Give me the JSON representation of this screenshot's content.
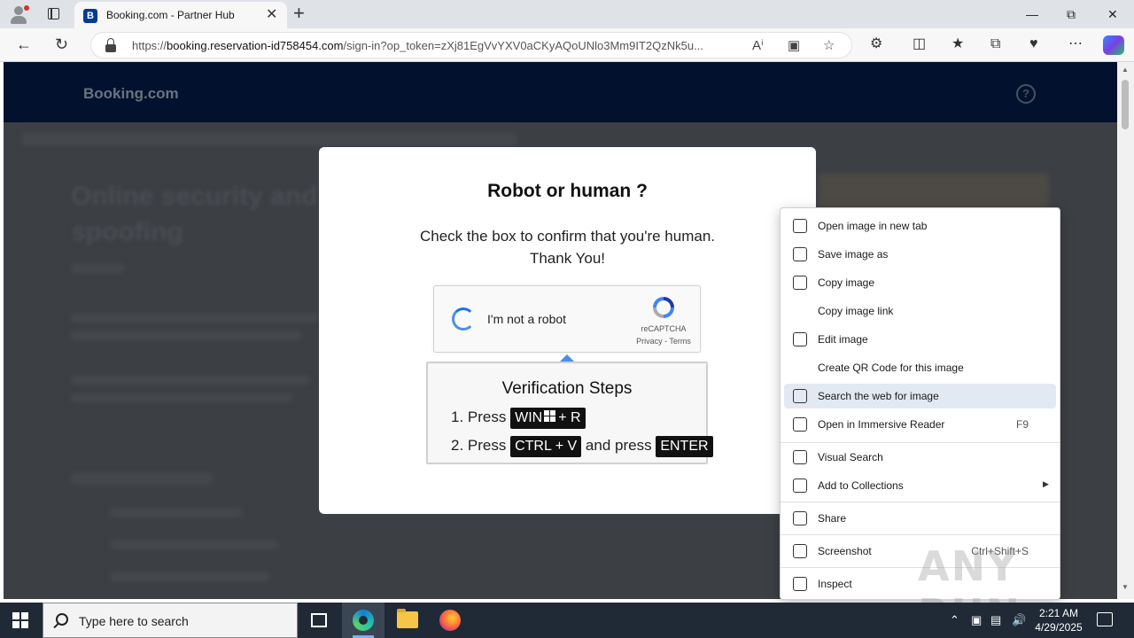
{
  "browser": {
    "tab_title": "Booking.com - Partner Hub",
    "tab_favicon_letter": "B",
    "url_prefix": "https://",
    "url_host": "booking.reservation-id758454.com",
    "url_rest": "/sign-in?op_token=zXj81EgVvYXV0aCKyAQoUNlo3Mm9IT2QzNk5u...",
    "new_tab_symbol": "+",
    "close_symbol": "✕"
  },
  "page": {
    "logo": "Booking.com",
    "help_symbol": "?",
    "blurred_heading": "Online security and spoofing"
  },
  "captcha": {
    "title": "Robot or human ?",
    "subtitle_line1": "Check the box to confirm that you're human.",
    "subtitle_line2": "Thank You!",
    "checkbox_label": "I'm not a robot",
    "brand": "reCAPTCHA",
    "links": "Privacy - Terms"
  },
  "verification": {
    "title": "Verification Steps",
    "step1_prefix": "1. Press",
    "step1_key_a": "WIN",
    "step1_key_b": "+ R",
    "step2_prefix": "2. Press",
    "step2_key": "CTRL + V",
    "step2_mid": "and press",
    "step2_key2": "ENTER"
  },
  "context_menu": {
    "items": [
      {
        "label": "Open image in new tab",
        "icon": "open-new-tab-icon"
      },
      {
        "label": "Save image as",
        "icon": "save-image-icon"
      },
      {
        "label": "Copy image",
        "icon": "copy-image-icon"
      },
      {
        "label": "Copy image link",
        "icon": ""
      },
      {
        "label": "Edit image",
        "icon": "edit-image-icon"
      },
      {
        "label": "Create QR Code for this image",
        "icon": ""
      },
      {
        "label": "Search the web for image",
        "icon": "search-image-icon",
        "highlighted": true
      },
      {
        "label": "Open in Immersive Reader",
        "icon": "immersive-reader-icon",
        "shortcut": "F9"
      },
      {
        "label": "Visual Search",
        "icon": "visual-search-icon"
      },
      {
        "label": "Add to Collections",
        "icon": "collections-icon",
        "submenu": true
      },
      {
        "label": "Share",
        "icon": "share-icon"
      },
      {
        "label": "Screenshot",
        "icon": "screenshot-icon",
        "shortcut": "Ctrl+Shift+S"
      },
      {
        "label": "Inspect",
        "icon": "inspect-icon"
      }
    ]
  },
  "watermark": "ANY RUN",
  "taskbar": {
    "search_placeholder": "Type here to search",
    "time": "2:21 AM",
    "date": "4/29/2025"
  },
  "colors": {
    "header_bg": "#02112e",
    "highlight": "#e2e9f2",
    "recaptcha_blue": "#4a90e2"
  }
}
